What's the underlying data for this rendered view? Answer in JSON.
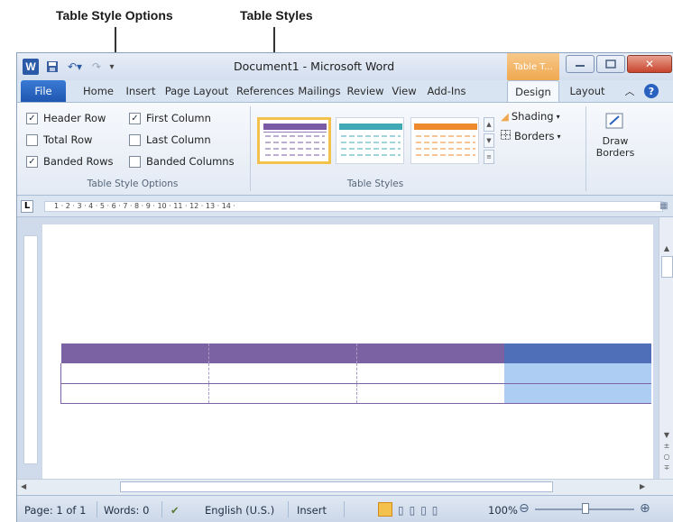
{
  "annotations": {
    "left_label": "Table Style Options",
    "right_label": "Table Styles"
  },
  "window": {
    "title": "Document1 - Microsoft Word",
    "context_tab": "Table T..."
  },
  "tabs": [
    "File",
    "Home",
    "Insert",
    "Page Layout",
    "References",
    "Mailings",
    "Review",
    "View",
    "Add-Ins",
    "Design",
    "Layout"
  ],
  "active_tab": "Design",
  "table_style_options": {
    "group_label": "Table Style Options",
    "options": [
      {
        "label": "Header Row",
        "checked": true
      },
      {
        "label": "First Column",
        "checked": true
      },
      {
        "label": "Total Row",
        "checked": false
      },
      {
        "label": "Last Column",
        "checked": false
      },
      {
        "label": "Banded Rows",
        "checked": true
      },
      {
        "label": "Banded Columns",
        "checked": false
      }
    ]
  },
  "table_styles": {
    "group_label": "Table Styles",
    "styles": [
      {
        "accent": "#7a5ba6",
        "selected": true
      },
      {
        "accent": "#3fa9b5",
        "selected": false
      },
      {
        "accent": "#ef8a2c",
        "selected": false
      }
    ]
  },
  "draw": {
    "shading_label": "Shading",
    "borders_label": "Borders",
    "draw_borders_line1": "Draw",
    "draw_borders_line2": "Borders"
  },
  "ruler_text": "1 · 2 · 3 · 4 · 5 · 6 · 7 · 8 · 9 · 10 · 11 · 12 · 13 · 14 ·",
  "document_table": {
    "header_color": "#7b63a3",
    "last_col_header_color": "#4f6fb8",
    "last_col_cell_color": "#aecdf2",
    "rows": 3,
    "cols": 4
  },
  "status": {
    "page": "Page: 1 of 1",
    "words": "Words: 0",
    "language": "English (U.S.)",
    "mode": "Insert",
    "zoom": "100%"
  },
  "colors": {
    "ribbon_bg": "#e3eaf4",
    "file_tab": "#2a62c0",
    "context_tab": "#f0a850"
  }
}
